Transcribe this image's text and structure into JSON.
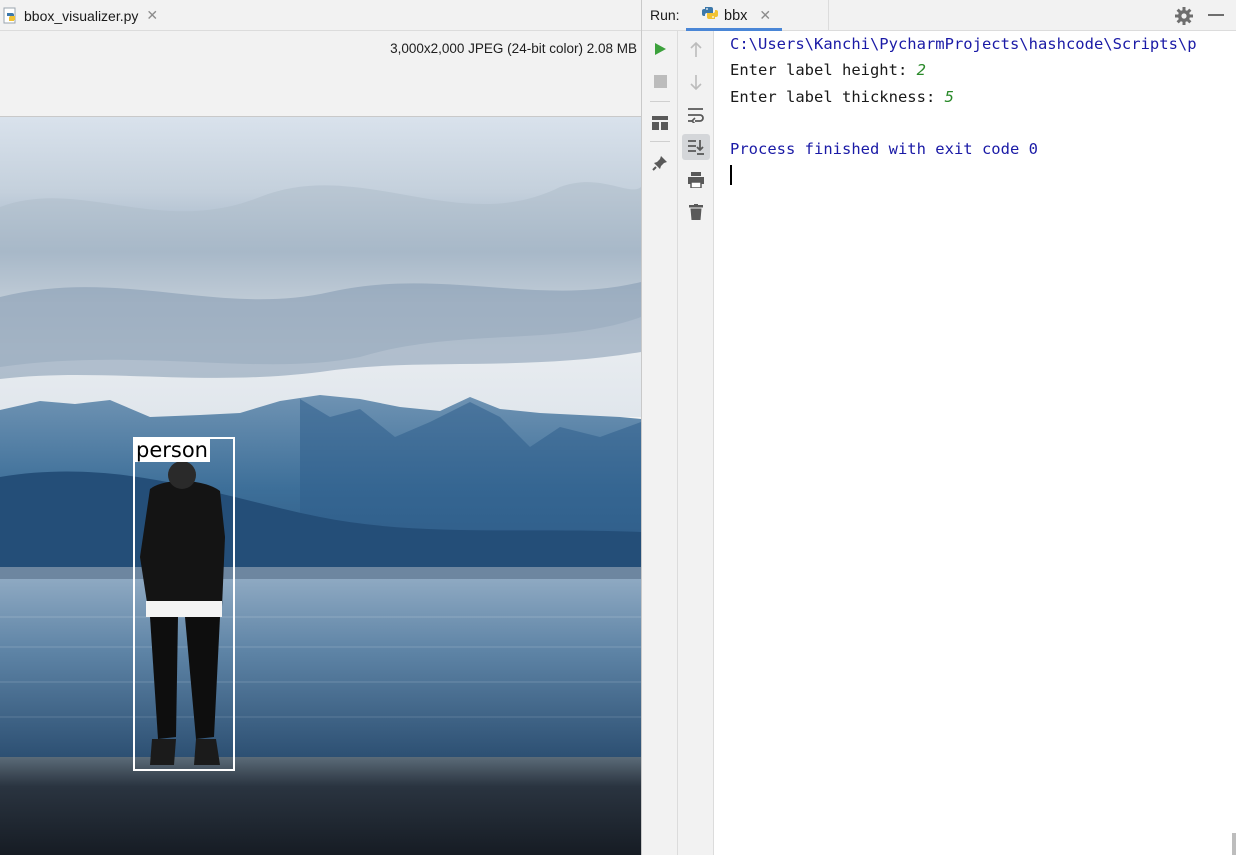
{
  "editor": {
    "tab_label": "bbox_visualizer.py",
    "tab_icon": "python-file-icon",
    "image_info": "3,000x2,000 JPEG (24-bit color) 2.08 MB",
    "bbox_label": "person"
  },
  "run_panel": {
    "title": "Run:",
    "tab_label": "bbx",
    "tab_icon": "python-icon",
    "toolbar_icons": [
      "rerun-icon",
      "stop-icon",
      "layout-icon",
      "pin-icon",
      "up-arrow-icon",
      "down-arrow-icon",
      "soft-wrap-icon",
      "scroll-to-end-icon",
      "print-icon",
      "trash-icon"
    ],
    "console": {
      "path_line": "C:\\Users\\Kanchi\\PycharmProjects\\hashcode\\Scripts\\p",
      "prompt1": "Enter label height: ",
      "input1": "2",
      "prompt2": "Enter label thickness: ",
      "input2": "5",
      "finished": "Process finished with exit code 0"
    }
  },
  "colors": {
    "accent": "#4a86d6",
    "run_green": "#3ca13c",
    "console_blue": "#1a1aa6",
    "input_green": "#2a8a2a"
  }
}
